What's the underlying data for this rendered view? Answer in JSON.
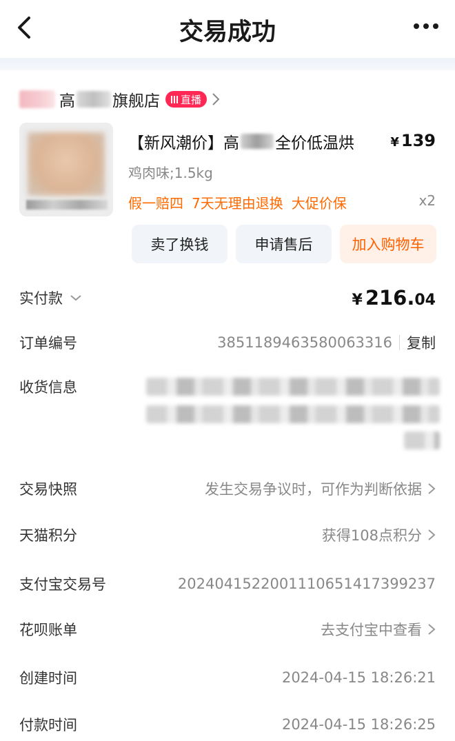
{
  "header": {
    "title": "交易成功"
  },
  "shop": {
    "name_part1": "高",
    "name_part2": "旗舰店",
    "live_label": "直播"
  },
  "product": {
    "title_part1": "【新风潮价】高",
    "title_part2": "全价低温烘",
    "price_symbol": "¥",
    "price": "139",
    "spec": "鸡肉味;1.5kg",
    "tags": [
      "假一赔四",
      "7天无理由退换",
      "大促价保"
    ],
    "quantity": "x2"
  },
  "actions": {
    "sell": "卖了换钱",
    "after_sale": "申请售后",
    "add_cart": "加入购物车"
  },
  "details": {
    "paid_label": "实付款",
    "paid_symbol": "¥",
    "paid_int": "216.",
    "paid_dec": "04",
    "order_no_label": "订单编号",
    "order_no": "3851189463580063316",
    "copy_label": "复制",
    "address_label": "收货信息",
    "snapshot_label": "交易快照",
    "snapshot_value": "发生交易争议时，可作为判断依据",
    "points_label": "天猫积分",
    "points_value": "获得108点积分",
    "alipay_no_label": "支付宝交易号",
    "alipay_no": "2024041522001110651417399237",
    "huabei_label": "花呗账单",
    "huabei_value": "去支付宝中查看",
    "created_label": "创建时间",
    "created_value": "2024-04-15 18:26:21",
    "paid_time_label": "付款时间",
    "paid_time_value": "2024-04-15 18:26:25"
  },
  "colors": {
    "accent_orange": "#ff6a00",
    "live_red": "#ff2855",
    "cart_bg": "#fff1e8"
  }
}
